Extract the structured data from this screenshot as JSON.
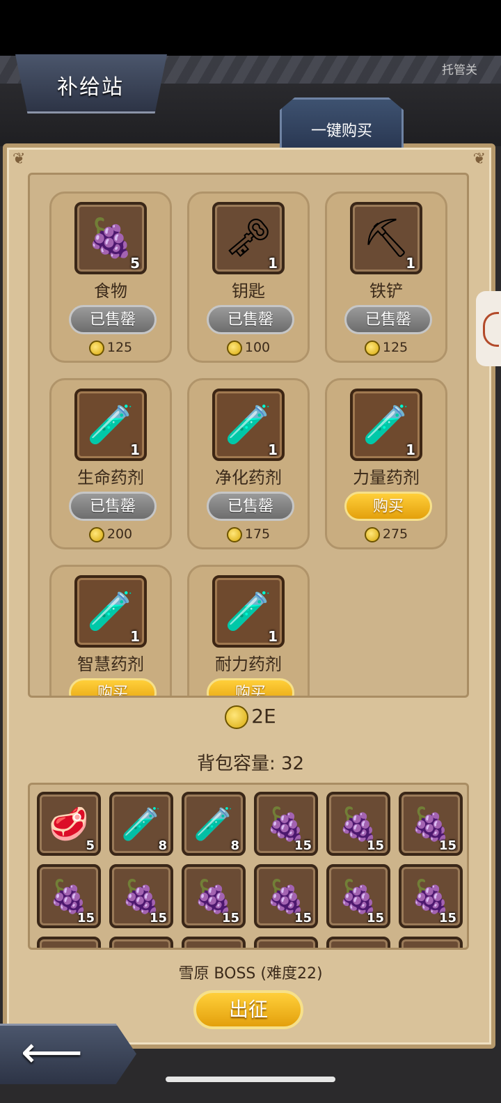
{
  "header": {
    "title": "补给站",
    "auto_label": "托管关",
    "onekey_buy": "一键购买"
  },
  "shop": {
    "items": [
      {
        "name": "食物",
        "icon": "food-icon",
        "glyph": "🍇",
        "count": "5",
        "status": "已售罄",
        "sold": true,
        "price": "125"
      },
      {
        "name": "钥匙",
        "icon": "key-icon",
        "glyph": "🗝",
        "count": "1",
        "status": "已售罄",
        "sold": true,
        "price": "100"
      },
      {
        "name": "铁铲",
        "icon": "shovel-icon",
        "glyph": "⛏",
        "count": "1",
        "status": "已售罄",
        "sold": true,
        "price": "125"
      },
      {
        "name": "生命药剂",
        "icon": "red-potion-icon",
        "glyph": "🧪",
        "count": "1",
        "status": "已售罄",
        "sold": true,
        "price": "200",
        "color": "#d6323c"
      },
      {
        "name": "净化药剂",
        "icon": "blue-potion-icon",
        "glyph": "🧪",
        "count": "1",
        "status": "已售罄",
        "sold": true,
        "price": "175",
        "color": "#3f82d8"
      },
      {
        "name": "力量药剂",
        "icon": "orange-potion-icon",
        "glyph": "🧪",
        "count": "1",
        "status": "购买",
        "sold": false,
        "price": "275",
        "color": "#e8552b"
      },
      {
        "name": "智慧药剂",
        "icon": "purple-potion-icon",
        "glyph": "🧪",
        "count": "1",
        "status": "购买",
        "sold": false,
        "price": "",
        "color": "#8a2ee0"
      },
      {
        "name": "耐力药剂",
        "icon": "yellow-potion-icon",
        "glyph": "🧪",
        "count": "1",
        "status": "购买",
        "sold": false,
        "price": "",
        "color": "#f2c44a"
      }
    ]
  },
  "gold": {
    "amount": "2E"
  },
  "bag": {
    "label": "背包容量: 32",
    "slots": [
      {
        "icon": "meat-icon",
        "glyph": "🥩",
        "count": "5"
      },
      {
        "icon": "red-potion-icon",
        "glyph": "🧪",
        "count": "8"
      },
      {
        "icon": "blue-potion-icon",
        "glyph": "🧪",
        "count": "8"
      },
      {
        "icon": "food-icon",
        "glyph": "🍇",
        "count": "15"
      },
      {
        "icon": "food-icon",
        "glyph": "🍇",
        "count": "15"
      },
      {
        "icon": "food-icon",
        "glyph": "🍇",
        "count": "15"
      },
      {
        "icon": "food-icon",
        "glyph": "🍇",
        "count": "15"
      },
      {
        "icon": "food-icon",
        "glyph": "🍇",
        "count": "15"
      },
      {
        "icon": "food-icon",
        "glyph": "🍇",
        "count": "15"
      },
      {
        "icon": "food-icon",
        "glyph": "🍇",
        "count": "15"
      },
      {
        "icon": "food-icon",
        "glyph": "🍇",
        "count": "15"
      },
      {
        "icon": "food-icon",
        "glyph": "🍇",
        "count": "15"
      }
    ]
  },
  "footer": {
    "boss_label": "雪原 BOSS (难度22)",
    "go_button": "出征",
    "back_icon": "back-arrow-icon"
  }
}
